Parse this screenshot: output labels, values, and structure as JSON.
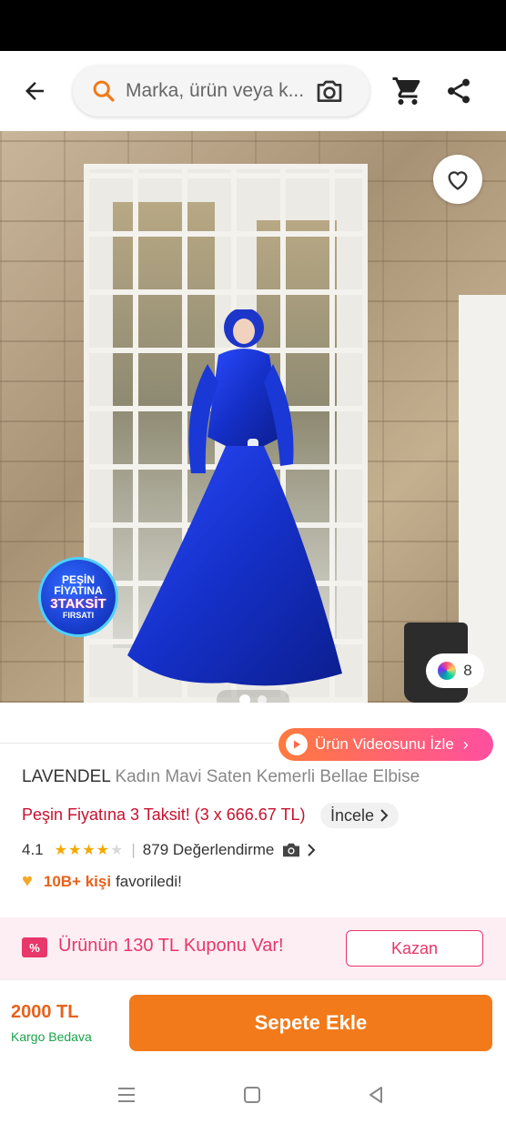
{
  "search": {
    "placeholder": "Marka, ürün veya k..."
  },
  "icons": {
    "back": "back-arrow-icon",
    "search": "search-icon",
    "camera": "camera-icon",
    "cart": "cart-icon",
    "share": "share-icon",
    "favorite": "heart-outline-icon",
    "color_palette": "color-palette-icon",
    "play": "play-icon",
    "coupon": "coupon-icon"
  },
  "gallery": {
    "promo_badge": {
      "line1": "PEŞİN",
      "line2": "FİYATINA",
      "line3": "3TAKSİT",
      "line4": "FIRSATI"
    },
    "color_count": "8",
    "page_count": 2,
    "current_page": 1
  },
  "video_button": {
    "label": "Ürün Videosunu İzle",
    "chevron": "›"
  },
  "product": {
    "brand": "LAVENDEL",
    "name": "Kadın Mavi Saten Kemerli Bellae Elbise",
    "installment": "Peşin Fiyatına 3 Taksit! (3 x 666.67 TL)",
    "installment_link": "İncele",
    "rating": "4.1",
    "rating_value": 4.1,
    "reviews": "879 Değerlendirme",
    "fav_count": "10B+ kişi",
    "fav_text": "favoriledi!"
  },
  "coupon": {
    "badge": "%",
    "text": "Ürünün 130 TL Kuponu Var!",
    "button": "Kazan"
  },
  "purchase": {
    "price": "2000 TL",
    "shipping": "Kargo Bedava",
    "button": "Sepete Ekle"
  },
  "colors": {
    "accent": "#f27a1a",
    "price": "#e8611a",
    "coupon": "#e8376a",
    "installment": "#c8102e",
    "shipping": "#1aa34a",
    "star": "#f2a900"
  }
}
